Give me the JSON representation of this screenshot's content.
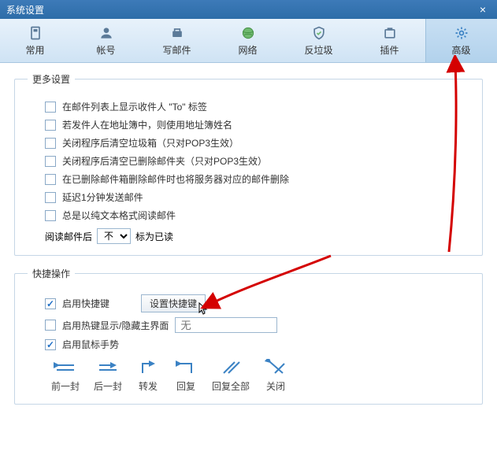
{
  "window": {
    "title": "系统设置"
  },
  "tabs": [
    {
      "label": "常用"
    },
    {
      "label": "帐号"
    },
    {
      "label": "写邮件"
    },
    {
      "label": "网络"
    },
    {
      "label": "反垃圾"
    },
    {
      "label": "插件"
    },
    {
      "label": "高级"
    }
  ],
  "more": {
    "legend": "更多设置",
    "items": [
      "在邮件列表上显示收件人 \"To\" 标签",
      "若发件人在地址簿中，则使用地址簿姓名",
      "关闭程序后清空垃圾箱（只对POP3生效）",
      "关闭程序后清空已删除邮件夹（只对POP3生效）",
      "在已删除邮件箱删除邮件时也将服务器对应的邮件删除",
      "延迟1分钟发送邮件",
      "总是以纯文本格式阅读邮件"
    ],
    "read_label": "阅读邮件后",
    "read_select": "不",
    "read_suffix": "标为已读"
  },
  "quick": {
    "legend": "快捷操作",
    "enable_shortcut": "启用快捷键",
    "set_shortcut_btn": "设置快捷键",
    "hotkey_toggle": "启用热键显示/隐藏主界面",
    "hotkey_placeholder": "无",
    "enable_mouse": "启用鼠标手势",
    "gestures": [
      {
        "label": "前一封"
      },
      {
        "label": "后一封"
      },
      {
        "label": "转发"
      },
      {
        "label": "回复"
      },
      {
        "label": "回复全部"
      },
      {
        "label": "关闭"
      }
    ]
  }
}
